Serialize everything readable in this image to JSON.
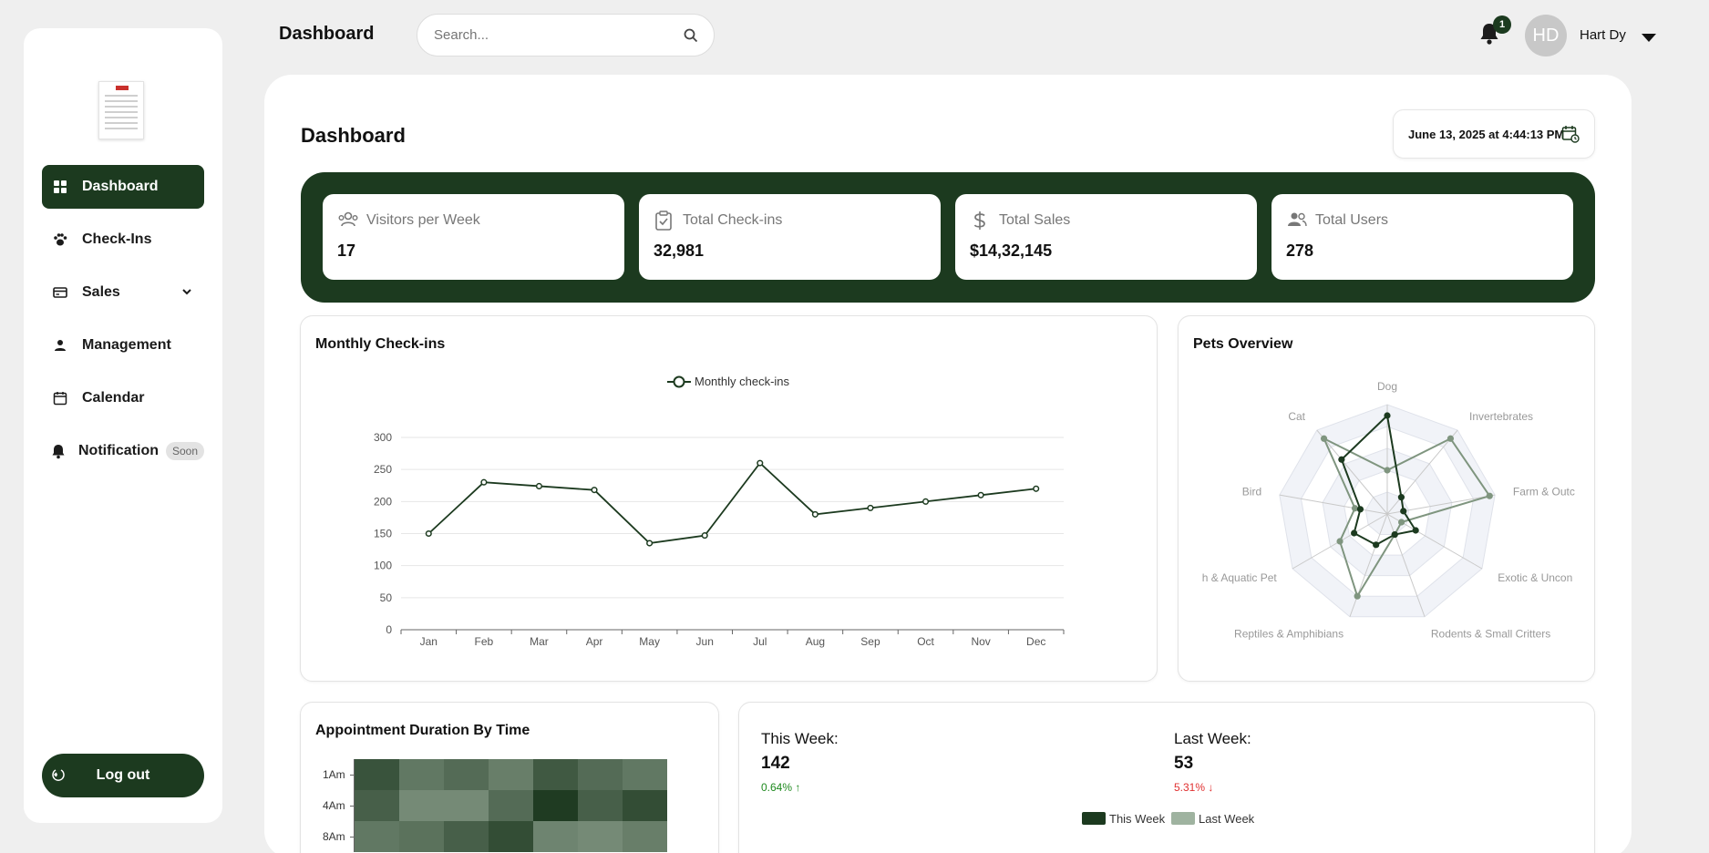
{
  "header": {
    "title": "Dashboard",
    "search_placeholder": "Search...",
    "notification_count": "1",
    "user_initials": "HD",
    "user_name": "Hart Dy"
  },
  "sidebar": {
    "items": [
      {
        "label": "Dashboard",
        "icon": "grid-icon",
        "active": true
      },
      {
        "label": "Check-Ins",
        "icon": "paw-icon"
      },
      {
        "label": "Sales",
        "icon": "card-icon"
      },
      {
        "label": "Management",
        "icon": "person-icon"
      },
      {
        "label": "Calendar",
        "icon": "calendar-icon"
      },
      {
        "label": "Notification",
        "icon": "bell-icon"
      }
    ],
    "soon_badge": "Soon",
    "logout_label": "Log out"
  },
  "main": {
    "title": "Dashboard",
    "datetime": "June 13, 2025 at 4:44:13 PM"
  },
  "stats": [
    {
      "label": "Visitors per Week",
      "value": "17",
      "icon": "users-icon"
    },
    {
      "label": "Total Check-ins",
      "value": "32,981",
      "icon": "clipboard-check-icon"
    },
    {
      "label": "Total Sales",
      "value": "$14,32,145",
      "icon": "dollar-icon"
    },
    {
      "label": "Total Users",
      "value": "278",
      "icon": "users-icon"
    }
  ],
  "monthly_checkins": {
    "title": "Monthly Check-ins",
    "legend": "Monthly check-ins"
  },
  "pets_overview": {
    "title": "Pets Overview"
  },
  "appointment": {
    "title": "Appointment Duration By Time",
    "rows": [
      "1Am",
      "4Am",
      "8Am"
    ]
  },
  "weekly": {
    "this_week_label": "This Week:",
    "this_week_value": "142",
    "this_week_change": "0.64% ↑",
    "last_week_label": "Last Week:",
    "last_week_value": "53",
    "last_week_change": "5.31% ↓",
    "legend_this": "This Week",
    "legend_last": "Last Week"
  },
  "colors": {
    "brand": "#1c3a1f",
    "up": "#1f8a1f",
    "down": "#e03030"
  },
  "chart_data": [
    {
      "type": "line",
      "title": "Monthly Check-ins",
      "categories": [
        "Jan",
        "Feb",
        "Mar",
        "Apr",
        "May",
        "Jun",
        "Jul",
        "Aug",
        "Sep",
        "Oct",
        "Nov",
        "Dec"
      ],
      "series": [
        {
          "name": "Monthly check-ins",
          "values": [
            150,
            230,
            224,
            218,
            135,
            147,
            260,
            180,
            190,
            200,
            210,
            220
          ]
        }
      ],
      "yticks": [
        0,
        50,
        100,
        150,
        200,
        250,
        300
      ],
      "ylim": [
        0,
        300
      ],
      "grid": true,
      "legend": "top-center"
    },
    {
      "type": "radar",
      "title": "Pets Overview",
      "categories": [
        "Dog",
        "Invertebrates",
        "Farm & Outdoor",
        "Exotic & Uncommon",
        "Rodents & Small Critters",
        "Reptiles & Amphibians",
        "Fish & Aquatic Pet",
        "Bird",
        "Cat"
      ],
      "category_labels": [
        "Dog",
        "Invertebrates",
        "Farm & Outc",
        "Exotic & Uncon",
        "Rodents & Small Critters",
        "Reptiles & Amphibians",
        "h & Aquatic Pet",
        "Bird",
        "Cat"
      ],
      "max": 10,
      "series": [
        {
          "values": [
            9,
            2,
            1.5,
            3,
            2,
            3,
            3.5,
            2.5,
            6.5
          ]
        },
        {
          "values": [
            4,
            9,
            9.5,
            1.5,
            2,
            8,
            5,
            3,
            9
          ]
        }
      ]
    },
    {
      "type": "heatmap",
      "title": "Appointment Duration By Time",
      "rows": [
        "1Am",
        "4Am",
        "8Am"
      ],
      "columns": 7,
      "values": [
        [
          0.75,
          0.45,
          0.55,
          0.4,
          0.7,
          0.55,
          0.45
        ],
        [
          0.65,
          0.3,
          0.3,
          0.55,
          0.95,
          0.65,
          0.8
        ],
        [
          0.45,
          0.5,
          0.65,
          0.8,
          0.35,
          0.3,
          0.4
        ]
      ]
    }
  ]
}
